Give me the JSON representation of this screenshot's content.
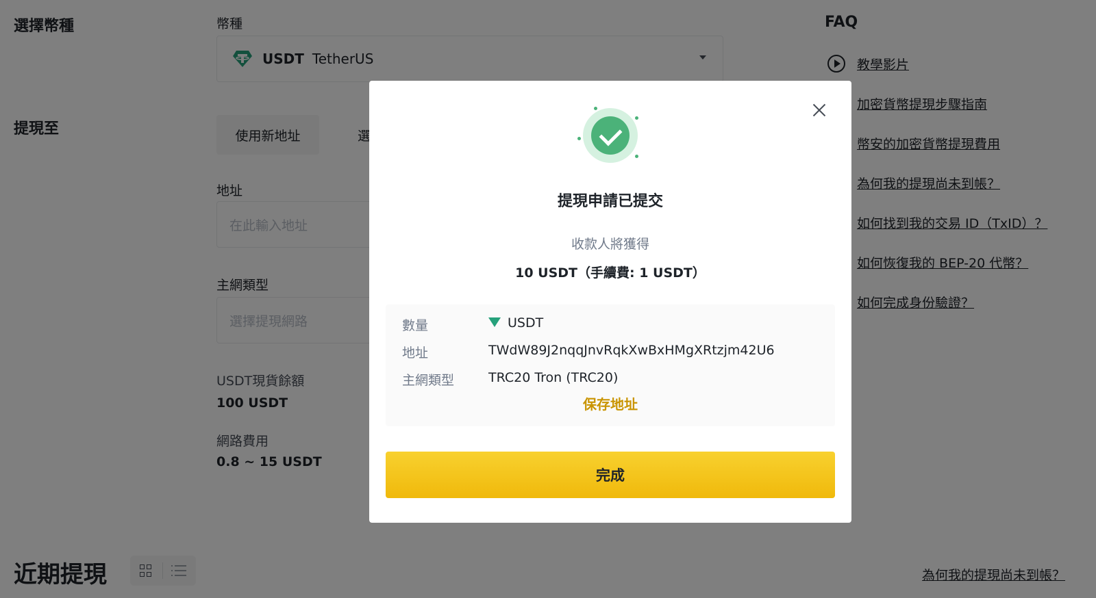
{
  "form": {
    "coin_label": "選擇幣種",
    "coin_field_label": "幣種",
    "coin_symbol": "USDT",
    "coin_name": "TetherUS",
    "withdraw_to_label": "提現至",
    "tab_new_address": "使用新地址",
    "tab_other": "選",
    "address_label": "地址",
    "address_placeholder": "在此輸入地址",
    "network_label": "主網類型",
    "network_placeholder": "選擇提現網路",
    "balance_label": "USDT現貨餘額",
    "balance_value": "100 USDT",
    "fee_label": "網路費用",
    "fee_value": "0.8 ~ 15 USDT"
  },
  "faq": {
    "title": "FAQ",
    "links": [
      "教學影片",
      "加密貨幣提現步驟指南",
      "幣安的加密貨幣提現費用",
      "為何我的提現尚未到帳？",
      "如何找到我的交易 ID（TxID）？",
      "如何恢復我的 BEP-20 代幣？",
      "如何完成身份驗證？"
    ]
  },
  "recent": {
    "title": "近期提現",
    "link": "為何我的提現尚未到帳？"
  },
  "modal": {
    "title": "提現申請已提交",
    "recipient_label": "收款人將獲得",
    "amount": "10 USDT（手續費: 1 USDT）",
    "details": {
      "quantity_key": "數量",
      "quantity_val": "USDT",
      "address_key": "地址",
      "address_val": "TWdW89J2nqqJnvRqkXwBxHMgXRtzjm42U6",
      "network_key": "主網類型",
      "network_val": "TRC20 Tron (TRC20)"
    },
    "save_address": "保存地址",
    "done_button": "完成"
  },
  "colors": {
    "accent_yellow": "#f0b90b",
    "success_green": "#4bb279",
    "link_gold": "#c99400"
  }
}
